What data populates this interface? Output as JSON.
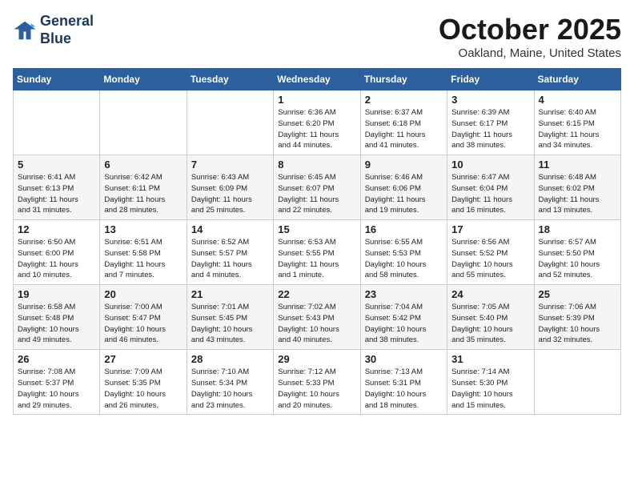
{
  "header": {
    "logo_line1": "General",
    "logo_line2": "Blue",
    "month": "October 2025",
    "location": "Oakland, Maine, United States"
  },
  "weekdays": [
    "Sunday",
    "Monday",
    "Tuesday",
    "Wednesday",
    "Thursday",
    "Friday",
    "Saturday"
  ],
  "weeks": [
    [
      {
        "day": "",
        "info": ""
      },
      {
        "day": "",
        "info": ""
      },
      {
        "day": "",
        "info": ""
      },
      {
        "day": "1",
        "info": "Sunrise: 6:36 AM\nSunset: 6:20 PM\nDaylight: 11 hours\nand 44 minutes."
      },
      {
        "day": "2",
        "info": "Sunrise: 6:37 AM\nSunset: 6:18 PM\nDaylight: 11 hours\nand 41 minutes."
      },
      {
        "day": "3",
        "info": "Sunrise: 6:39 AM\nSunset: 6:17 PM\nDaylight: 11 hours\nand 38 minutes."
      },
      {
        "day": "4",
        "info": "Sunrise: 6:40 AM\nSunset: 6:15 PM\nDaylight: 11 hours\nand 34 minutes."
      }
    ],
    [
      {
        "day": "5",
        "info": "Sunrise: 6:41 AM\nSunset: 6:13 PM\nDaylight: 11 hours\nand 31 minutes."
      },
      {
        "day": "6",
        "info": "Sunrise: 6:42 AM\nSunset: 6:11 PM\nDaylight: 11 hours\nand 28 minutes."
      },
      {
        "day": "7",
        "info": "Sunrise: 6:43 AM\nSunset: 6:09 PM\nDaylight: 11 hours\nand 25 minutes."
      },
      {
        "day": "8",
        "info": "Sunrise: 6:45 AM\nSunset: 6:07 PM\nDaylight: 11 hours\nand 22 minutes."
      },
      {
        "day": "9",
        "info": "Sunrise: 6:46 AM\nSunset: 6:06 PM\nDaylight: 11 hours\nand 19 minutes."
      },
      {
        "day": "10",
        "info": "Sunrise: 6:47 AM\nSunset: 6:04 PM\nDaylight: 11 hours\nand 16 minutes."
      },
      {
        "day": "11",
        "info": "Sunrise: 6:48 AM\nSunset: 6:02 PM\nDaylight: 11 hours\nand 13 minutes."
      }
    ],
    [
      {
        "day": "12",
        "info": "Sunrise: 6:50 AM\nSunset: 6:00 PM\nDaylight: 11 hours\nand 10 minutes."
      },
      {
        "day": "13",
        "info": "Sunrise: 6:51 AM\nSunset: 5:58 PM\nDaylight: 11 hours\nand 7 minutes."
      },
      {
        "day": "14",
        "info": "Sunrise: 6:52 AM\nSunset: 5:57 PM\nDaylight: 11 hours\nand 4 minutes."
      },
      {
        "day": "15",
        "info": "Sunrise: 6:53 AM\nSunset: 5:55 PM\nDaylight: 11 hours\nand 1 minute."
      },
      {
        "day": "16",
        "info": "Sunrise: 6:55 AM\nSunset: 5:53 PM\nDaylight: 10 hours\nand 58 minutes."
      },
      {
        "day": "17",
        "info": "Sunrise: 6:56 AM\nSunset: 5:52 PM\nDaylight: 10 hours\nand 55 minutes."
      },
      {
        "day": "18",
        "info": "Sunrise: 6:57 AM\nSunset: 5:50 PM\nDaylight: 10 hours\nand 52 minutes."
      }
    ],
    [
      {
        "day": "19",
        "info": "Sunrise: 6:58 AM\nSunset: 5:48 PM\nDaylight: 10 hours\nand 49 minutes."
      },
      {
        "day": "20",
        "info": "Sunrise: 7:00 AM\nSunset: 5:47 PM\nDaylight: 10 hours\nand 46 minutes."
      },
      {
        "day": "21",
        "info": "Sunrise: 7:01 AM\nSunset: 5:45 PM\nDaylight: 10 hours\nand 43 minutes."
      },
      {
        "day": "22",
        "info": "Sunrise: 7:02 AM\nSunset: 5:43 PM\nDaylight: 10 hours\nand 40 minutes."
      },
      {
        "day": "23",
        "info": "Sunrise: 7:04 AM\nSunset: 5:42 PM\nDaylight: 10 hours\nand 38 minutes."
      },
      {
        "day": "24",
        "info": "Sunrise: 7:05 AM\nSunset: 5:40 PM\nDaylight: 10 hours\nand 35 minutes."
      },
      {
        "day": "25",
        "info": "Sunrise: 7:06 AM\nSunset: 5:39 PM\nDaylight: 10 hours\nand 32 minutes."
      }
    ],
    [
      {
        "day": "26",
        "info": "Sunrise: 7:08 AM\nSunset: 5:37 PM\nDaylight: 10 hours\nand 29 minutes."
      },
      {
        "day": "27",
        "info": "Sunrise: 7:09 AM\nSunset: 5:35 PM\nDaylight: 10 hours\nand 26 minutes."
      },
      {
        "day": "28",
        "info": "Sunrise: 7:10 AM\nSunset: 5:34 PM\nDaylight: 10 hours\nand 23 minutes."
      },
      {
        "day": "29",
        "info": "Sunrise: 7:12 AM\nSunset: 5:33 PM\nDaylight: 10 hours\nand 20 minutes."
      },
      {
        "day": "30",
        "info": "Sunrise: 7:13 AM\nSunset: 5:31 PM\nDaylight: 10 hours\nand 18 minutes."
      },
      {
        "day": "31",
        "info": "Sunrise: 7:14 AM\nSunset: 5:30 PM\nDaylight: 10 hours\nand 15 minutes."
      },
      {
        "day": "",
        "info": ""
      }
    ]
  ]
}
